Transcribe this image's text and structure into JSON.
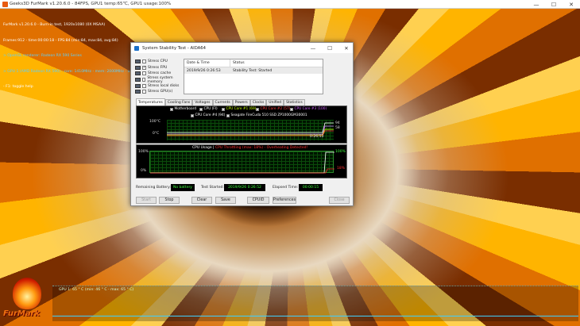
{
  "furmark_window": {
    "title": "Geeks3D FurMark v1.20.6.0 - 84FPS, GPU1 temp:65℃, GPU1 usage:100%",
    "controls": [
      "—",
      "☐",
      "✕"
    ]
  },
  "furmark_overlay": {
    "lines": [
      {
        "text": "FurMark v1.20.6.0 - Burn-in test, 1920x1080 (0X MSAA)",
        "color": "w"
      },
      {
        "text": "Frames:912 - time:00:00:18 - FPS:84 (min:84, max:84, avg:84)",
        "color": "w"
      },
      {
        "text": "> OpenGL renderer: Radeon RX 590 Series",
        "color": "c"
      },
      {
        "text": "> GPU 1 (AMD Radeon RX 590) - core: 1410MHz - mem: 2000MHz - usage: 100% - temp: 65 °C - GPU load: 100%",
        "color": "c"
      },
      {
        "text": "- F1: toggle help",
        "color": "w"
      }
    ]
  },
  "furmark_graph": {
    "label": "GPU 1: 65 ° C (min: 46 ° C - max: 65 ° C)"
  },
  "furmark_logo": {
    "text": "FurMark"
  },
  "aida_window": {
    "title": "System Stability Test - AIDA64",
    "controls": [
      "—",
      "☐",
      "✕"
    ],
    "stress_options": [
      {
        "label": "Stress CPU",
        "checked": false
      },
      {
        "label": "Stress FPU",
        "checked": true
      },
      {
        "label": "Stress cache",
        "checked": false
      },
      {
        "label": "Stress system memory",
        "checked": false
      },
      {
        "label": "Stress local disks",
        "checked": false
      },
      {
        "label": "Stress GPU(s)",
        "checked": false
      }
    ],
    "status_table": {
      "columns": [
        "Date & Time",
        "Status"
      ],
      "rows": [
        [
          "2019/9/26 0:26:53",
          "Stability Test: Started"
        ]
      ]
    },
    "tabs": [
      "Temperatures",
      "Cooling Fans",
      "Voltages",
      "Currents",
      "Powers",
      "Clocks",
      "Unified",
      "Statistics"
    ],
    "active_tab": "Temperatures",
    "temp_legend": [
      {
        "label": "Motherboard",
        "color": "#ffffff"
      },
      {
        "label": "CPU (FI)",
        "color": "#ffffff"
      },
      {
        "label": "CPU Core #1 (69)",
        "color": "#c8ff00"
      },
      {
        "label": "CPU Core #2 (57)",
        "color": "#ff4040"
      },
      {
        "label": "CPU Core #3 (100)",
        "color": "#d060ff"
      },
      {
        "label": "CPU Core #4 (94)",
        "color": "#ffffff"
      },
      {
        "label": "Seagate FireCuda 510 SSD ZP1000GM30001",
        "color": "#ffffff"
      }
    ],
    "temp_axis": {
      "top": "100°C",
      "bottom": "0°C",
      "time": "0:26:53",
      "right_value_1": "94",
      "right_value_2": "58"
    },
    "cpu_usage": {
      "title": "CPU Usage",
      "title_sep": "|",
      "warning": "CPU Throttling (max: 18%) - Overheating Detected!",
      "axis_top_left": "100%",
      "axis_bottom_left": "0%",
      "axis_top_right": "100%",
      "axis_bottom_right": "18%"
    },
    "info": {
      "battery_label": "Remaining Battery:",
      "battery_value": "No battery",
      "started_label": "Test Started:",
      "started_value": "2019/9/26 0:26:52",
      "elapsed_label": "Elapsed Time:",
      "elapsed_value": "00:00:15"
    },
    "buttons": {
      "start": "Start",
      "stop": "Stop",
      "clear": "Clear",
      "save": "Save",
      "cpuid": "CPUID",
      "preferences": "Preferences",
      "close": "Close"
    }
  }
}
